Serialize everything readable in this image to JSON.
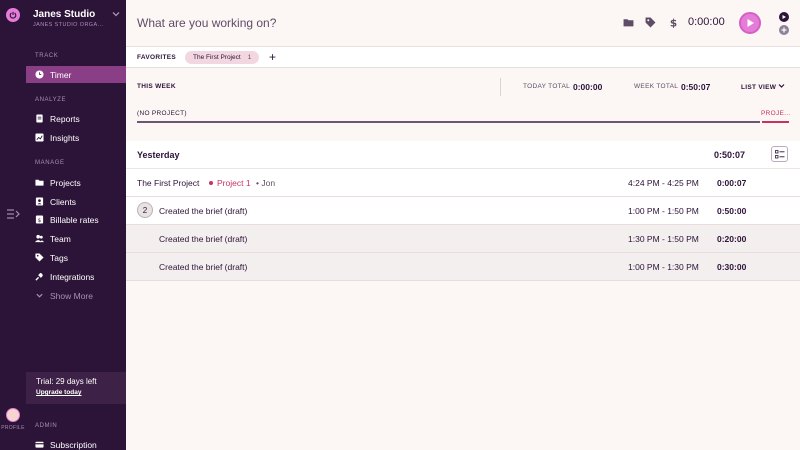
{
  "workspace": {
    "name": "Janes Studio",
    "subtitle": "JANES STUDIO ORGA..."
  },
  "rail": {
    "profile_label": "PROFILE"
  },
  "sidebar": {
    "sections": {
      "track": "TRACK",
      "analyze": "ANALYZE",
      "manage": "MANAGE",
      "admin": "ADMIN"
    },
    "items": {
      "timer": "Timer",
      "reports": "Reports",
      "insights": "Insights",
      "projects": "Projects",
      "clients": "Clients",
      "billable_rates": "Billable rates",
      "team": "Team",
      "tags": "Tags",
      "integrations": "Integrations",
      "show_more": "Show More",
      "subscription": "Subscription"
    },
    "trial": {
      "text": "Trial: 29 days left",
      "link": "Upgrade today"
    }
  },
  "topbar": {
    "placeholder": "What are you working on?",
    "timer": "0:00:00",
    "icons": [
      "folder-icon",
      "tag-icon",
      "dollar-icon",
      "play-icon",
      "timer-mode-icon",
      "manual-mode-icon"
    ]
  },
  "favorites": {
    "label": "FAVORITES",
    "chip": "The First Project",
    "chip_count": "1",
    "add": "+"
  },
  "week": {
    "label": "THIS WEEK",
    "today_label": "TODAY TOTAL",
    "today_value": "0:00:00",
    "week_label": "WEEK TOTAL",
    "week_value": "0:50:07",
    "list_view": "LIST VIEW",
    "no_project": "(NO PROJECT)",
    "project_label": "PROJE..."
  },
  "day": {
    "title": "Yesterday",
    "total": "0:50:07",
    "entries": [
      {
        "desc": "The First Project",
        "project": "Project 1",
        "client": "Jon",
        "range": "4:24 PM - 4:25 PM",
        "duration": "0:00:07"
      },
      {
        "count": "2",
        "desc": "Created the brief (draft)",
        "range": "1:00 PM - 1:50 PM",
        "duration": "0:50:00"
      },
      {
        "desc": "Created the brief (draft)",
        "range": "1:30 PM - 1:50 PM",
        "duration": "0:20:00"
      },
      {
        "desc": "Created the brief (draft)",
        "range": "1:00 PM - 1:30 PM",
        "duration": "0:30:00"
      }
    ]
  },
  "colors": {
    "sidebar_bg": "#2c1338",
    "accent": "#e57cd8",
    "active_item": "#8a3e86",
    "project": "#c4345f"
  }
}
